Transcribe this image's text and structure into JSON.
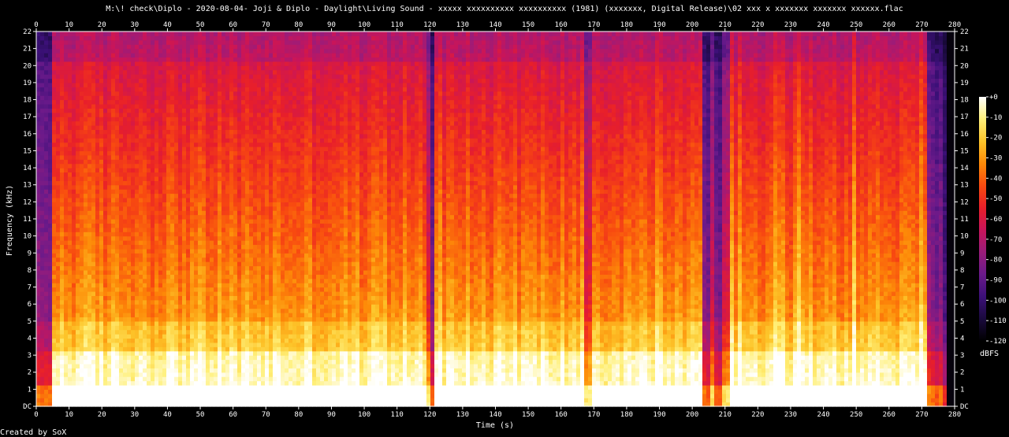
{
  "title": "M:\\! check\\Diplo - 2020-08-04- Joji & Diplo - Daylight\\Living Sound - xxxxx xxxxxxxxxx xxxxxxxxxx (1981) (xxxxxxx, Digital Release)\\02 xxx x xxxxxxx xxxxxxx xxxxxx.flac",
  "credit": "Created by SoX",
  "colors": {
    "background": "#000000",
    "axis": "#ffffff"
  },
  "chart_data": {
    "type": "heatmap",
    "title": "M:\\! check\\Diplo - 2020-08-04- Joji & Diplo - Daylight\\Living Sound - xxxxx xxxxxxxxxx xxxxxxxxxx (1981) (xxxxxxx, Digital Release)\\02 xxx x xxxxxxx xxxxxxx xxxxxx.flac",
    "xlabel": "Time (s)",
    "ylabel": "Frequency (kHz)",
    "xlim": [
      0,
      280
    ],
    "ylim": [
      0,
      22
    ],
    "x_ticks": [
      "0",
      "10",
      "20",
      "30",
      "40",
      "50",
      "60",
      "70",
      "80",
      "90",
      "100",
      "110",
      "120",
      "130",
      "140",
      "150",
      "160",
      "170",
      "180",
      "190",
      "200",
      "210",
      "220",
      "230",
      "240",
      "250",
      "260",
      "270",
      "280"
    ],
    "y_ticks": [
      "DC",
      "1",
      "2",
      "3",
      "4",
      "5",
      "6",
      "7",
      "8",
      "9",
      "10",
      "11",
      "12",
      "13",
      "14",
      "15",
      "16",
      "17",
      "18",
      "19",
      "20",
      "21",
      "22"
    ],
    "colorbar": {
      "label": "dBFS",
      "range": [
        -120,
        0
      ],
      "ticks": [
        "+0",
        "-10",
        "-20",
        "-30",
        "-40",
        "-50",
        "-60",
        "-70",
        "-80",
        "-90",
        "-100",
        "-110",
        "-120"
      ],
      "colors": [
        "#000000",
        "#1a0a3d",
        "#3c1078",
        "#6a1a8a",
        "#9a1c7a",
        "#c8155a",
        "#e81f2a",
        "#f84a10",
        "#fd8a08",
        "#fdc52a",
        "#fff07a",
        "#ffffff"
      ]
    },
    "duration_s": 278,
    "intro_quiet_until_s": 5,
    "loud_sections_s": [
      [
        5,
        120
      ],
      [
        121,
        203
      ],
      [
        212,
        272
      ]
    ],
    "dip_points_s": [
      120,
      168,
      204,
      208
    ]
  }
}
